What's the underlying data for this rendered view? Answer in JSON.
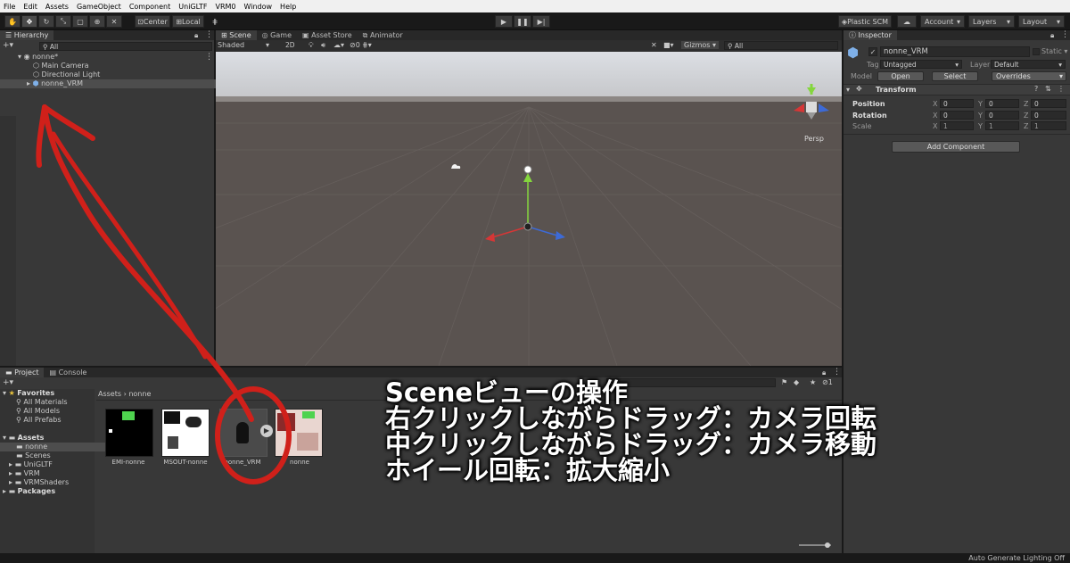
{
  "menu": [
    "File",
    "Edit",
    "Assets",
    "GameObject",
    "Component",
    "UniGLTF",
    "VRM0",
    "Window",
    "Help"
  ],
  "toolbar": {
    "center_label": "Center",
    "local_label": "Local",
    "plastic_label": "Plastic SCM",
    "account_label": "Account",
    "layers_label": "Layers",
    "layout_label": "Layout"
  },
  "hierarchy": {
    "tab": "Hierarchy",
    "search_placeholder": "All",
    "scene_name": "nonne*",
    "items": [
      "Main Camera",
      "Directional Light",
      "nonne_VRM"
    ]
  },
  "scene": {
    "tabs": [
      "Scene",
      "Game",
      "Asset Store",
      "Animator"
    ],
    "shading": "Shaded",
    "mode_2d": "2D",
    "gizmos_label": "Gizmos",
    "search_placeholder": "All",
    "persp_label": "Persp",
    "fx_count": "0"
  },
  "inspector": {
    "tab": "Inspector",
    "object_name": "nonne_VRM",
    "static_label": "Static",
    "tag_label": "Tag",
    "tag_value": "Untagged",
    "layer_label": "Layer",
    "layer_value": "Default",
    "model_label": "Model",
    "open_label": "Open",
    "select_label": "Select",
    "overrides_label": "Overrides",
    "transform_title": "Transform",
    "position_label": "Position",
    "rotation_label": "Rotation",
    "scale_label": "Scale",
    "position": {
      "x": "0",
      "y": "0",
      "z": "0"
    },
    "rotation": {
      "x": "0",
      "y": "0",
      "z": "0"
    },
    "scale": {
      "x": "1",
      "y": "1",
      "z": "1"
    },
    "add_component": "Add Component"
  },
  "project": {
    "tabs": [
      "Project",
      "Console"
    ],
    "favorites_label": "Favorites",
    "favorites": [
      "All Materials",
      "All Models",
      "All Prefabs"
    ],
    "assets_label": "Assets",
    "asset_folders": [
      "nonne",
      "Scenes",
      "UniGLTF",
      "VRM",
      "VRMShaders"
    ],
    "packages_label": "Packages",
    "breadcrumb_root": "Assets",
    "breadcrumb_current": "nonne",
    "thumbnails": [
      "EMI-nonne",
      "MSOUT-nonne",
      "nonne_VRM",
      "nonne"
    ],
    "badge_count": "1"
  },
  "overlay": {
    "lines": [
      "Sceneビューの操作",
      "右クリックしながらドラッグ：カメラ回転",
      "中クリックしながらドラッグ：カメラ移動",
      "ホイール回転：拡大縮小"
    ],
    "annotation_color": "#d0201a"
  },
  "status": {
    "right": "Auto Generate Lighting Off"
  }
}
